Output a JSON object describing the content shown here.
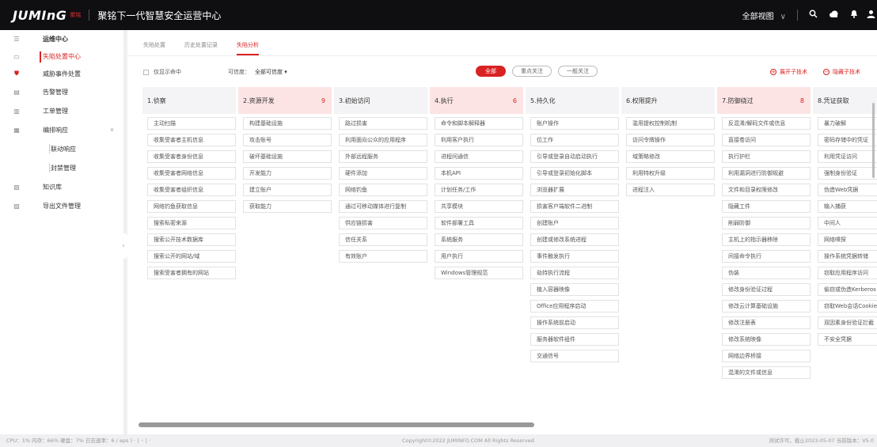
{
  "topbar": {
    "logo": "JUMInG",
    "logo_cn": "聚铭",
    "title": "聚铭下一代智慧安全运营中心",
    "view_label": "全部视图",
    "view_chevron": "∨",
    "icons": [
      "search-icon",
      "cloud-icon",
      "bell-icon",
      "user-icon"
    ]
  },
  "sidebar": {
    "items": [
      {
        "icon": "menu-icon",
        "label": "运维中心"
      },
      {
        "icon": "monitor-icon",
        "label": "失陷处置中心"
      },
      {
        "icon": "shield-icon",
        "label": "威胁事件处置"
      },
      {
        "icon": "alarm-icon",
        "label": "告警管理"
      },
      {
        "icon": "ticket-icon",
        "label": "工单管理"
      },
      {
        "icon": "response-icon",
        "label": "编排响应",
        "chevron": "∨"
      },
      {
        "label": "联动响应"
      },
      {
        "label": "封禁管理"
      },
      {
        "icon": "book-icon",
        "label": "知识库"
      },
      {
        "icon": "export-icon",
        "label": "导出文件管理"
      }
    ],
    "collapse_glyph": "‹"
  },
  "tabs": [
    {
      "label": "失陷处置"
    },
    {
      "label": "历史处置记录"
    },
    {
      "label": "失陷分析"
    }
  ],
  "filters": {
    "only_hit_label": "仅显示命中",
    "confidence_label": "可信度：",
    "confidence_value": "全部可信度 ▾",
    "pills": [
      "全部",
      "重点关注",
      "一般关注"
    ],
    "expand_label": "展开子技术",
    "hide_label": "隐藏子技术",
    "expand_glyph": "+",
    "hide_glyph": "−"
  },
  "columns": [
    {
      "title": "1.侦察",
      "count": "",
      "highlight": false,
      "items": [
        {
          "t": "主动扫描",
          "s": true
        },
        {
          "t": "收集受害者主机信息",
          "s": true
        },
        {
          "t": "收集受害者身份信息",
          "s": true
        },
        {
          "t": "收集受害者网络信息",
          "s": true
        },
        {
          "t": "收集受害者组织信息",
          "s": true
        },
        {
          "t": "网络钓鱼获取信息",
          "s": true
        },
        {
          "t": "搜索私密来源",
          "s": false
        },
        {
          "t": "搜索公开技术数据库",
          "s": true
        },
        {
          "t": "搜索公开的网站/域",
          "s": true
        },
        {
          "t": "搜索受害者拥有的网站",
          "s": false
        }
      ]
    },
    {
      "title": "2.资源开发",
      "count": "9",
      "highlight": true,
      "items": [
        {
          "t": "构建基础设施",
          "s": true
        },
        {
          "t": "攻击账号",
          "s": true
        },
        {
          "t": "破坏基础设施",
          "s": true
        },
        {
          "t": "开发能力",
          "s": true
        },
        {
          "t": "建立账户",
          "s": true
        },
        {
          "t": "获取能力",
          "s": true
        }
      ]
    },
    {
      "title": "3.初始访问",
      "count": "",
      "highlight": false,
      "items": [
        {
          "t": "路过损害",
          "s": false
        },
        {
          "t": "利用面向公众的应用程序",
          "s": false
        },
        {
          "t": "外部远程服务",
          "s": false
        },
        {
          "t": "硬件添加",
          "s": false
        },
        {
          "t": "网络钓鱼",
          "s": true
        },
        {
          "t": "通过可移动媒体进行复制",
          "s": false
        },
        {
          "t": "供应链损害",
          "s": true
        },
        {
          "t": "信任关系",
          "s": false
        },
        {
          "t": "有效账户",
          "s": true
        }
      ]
    },
    {
      "title": "4.执行",
      "count": "6",
      "highlight": true,
      "items": [
        {
          "t": "命令和脚本解释器",
          "s": true
        },
        {
          "t": "利用客户执行",
          "s": false
        },
        {
          "t": "进程间通信",
          "s": true
        },
        {
          "t": "本机API",
          "s": false
        },
        {
          "t": "计划任务/工作",
          "s": true
        },
        {
          "t": "共享模块",
          "s": false
        },
        {
          "t": "软件部署工具",
          "s": false
        },
        {
          "t": "系统服务",
          "s": true
        },
        {
          "t": "用户执行",
          "s": true
        },
        {
          "t": "Windows管理规范",
          "s": false
        }
      ]
    },
    {
      "title": "5.持久化",
      "count": "",
      "highlight": false,
      "items": [
        {
          "t": "账户操作",
          "s": true
        },
        {
          "t": "位工作",
          "s": false
        },
        {
          "t": "引导或登录自动启动执行",
          "s": true
        },
        {
          "t": "引导或登录初始化脚本",
          "s": true
        },
        {
          "t": "浏览器扩展",
          "s": false
        },
        {
          "t": "损害客户端软件二进制",
          "s": false
        },
        {
          "t": "创建账户",
          "s": true
        },
        {
          "t": "创建或修改系统进程",
          "s": true
        },
        {
          "t": "事件触发执行",
          "s": true
        },
        {
          "t": "劫持执行流程",
          "s": true
        },
        {
          "t": "植入容器映像",
          "s": false
        },
        {
          "t": "Office应用程序启动",
          "s": true
        },
        {
          "t": "操作系统前启动",
          "s": true
        },
        {
          "t": "服务器软件组件",
          "s": true
        },
        {
          "t": "交通信号",
          "s": true
        }
      ]
    },
    {
      "title": "6.权限提升",
      "count": "",
      "highlight": false,
      "items": [
        {
          "t": "滥用提权控制机制",
          "s": true
        },
        {
          "t": "访问令牌操作",
          "s": true
        },
        {
          "t": "域策略修改",
          "s": true
        },
        {
          "t": "利用特权升级",
          "s": false
        },
        {
          "t": "进程注入",
          "s": true
        }
      ]
    },
    {
      "title": "7.防御绕过",
      "count": "8",
      "highlight": true,
      "items": [
        {
          "t": "反混淆/解码文件或信息",
          "s": false
        },
        {
          "t": "直接卷访问",
          "s": false
        },
        {
          "t": "执行护栏",
          "s": true
        },
        {
          "t": "利用漏洞进行防御规避",
          "s": false
        },
        {
          "t": "文件和目录权限修改",
          "s": true
        },
        {
          "t": "隐藏工件",
          "s": true
        },
        {
          "t": "削弱防御",
          "s": true
        },
        {
          "t": "主机上的指示器移除",
          "s": true
        },
        {
          "t": "间接命令执行",
          "s": false
        },
        {
          "t": "伪装",
          "s": true
        },
        {
          "t": "修改身份验证过程",
          "s": true
        },
        {
          "t": "修改云计算基础设施",
          "s": true
        },
        {
          "t": "修改注册表",
          "s": false
        },
        {
          "t": "修改系统映像",
          "s": true
        },
        {
          "t": "网络边界桥接",
          "s": true
        },
        {
          "t": "混淆的文件或信息",
          "s": true
        }
      ]
    },
    {
      "title": "8.凭证获取",
      "count": "",
      "highlight": false,
      "items": [
        {
          "t": "暴力破解",
          "s": true
        },
        {
          "t": "密码存储中的凭证",
          "s": true
        },
        {
          "t": "利用凭证访问",
          "s": false
        },
        {
          "t": "强制身份验证",
          "s": false
        },
        {
          "t": "伪造Web凭据",
          "s": true
        },
        {
          "t": "输入捕获",
          "s": true
        },
        {
          "t": "中间人",
          "s": true
        },
        {
          "t": "网络嗅探",
          "s": false
        },
        {
          "t": "操作系统凭据转储",
          "s": true
        },
        {
          "t": "窃取应用程序访问",
          "s": false
        },
        {
          "t": "偷窃或伪造Kerberos",
          "s": true
        },
        {
          "t": "窃取Web会话Cookie",
          "s": false
        },
        {
          "t": "双因素身份验证拦截",
          "s": false
        },
        {
          "t": "不安全凭据",
          "s": true
        }
      ]
    }
  ],
  "footer": {
    "left": "CPU：1%   内存：66%   硬盘：7%     日志速率：6 / eps )     ·  |  ··  |  ·",
    "center": "Copyright©2022 JUMINFO.COM All Rights Reserved",
    "right": "测试许可，截止2023-05-07    当前版本：V5.0"
  },
  "colors": {
    "accent": "#d92323",
    "topbar": "#0f0f12",
    "highlight_head": "#fde4e4"
  }
}
